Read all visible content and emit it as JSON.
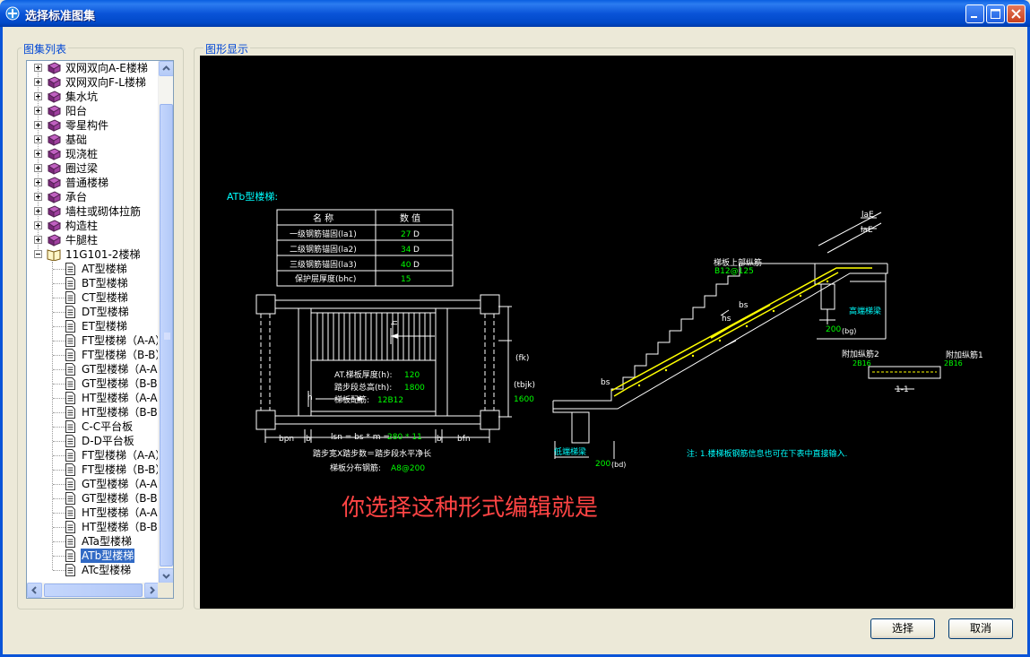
{
  "window": {
    "title": "选择标准图集",
    "colors": {
      "titlebar": "#0a54d8",
      "selection": "#316ac5",
      "drawing_bg": "#000000",
      "accent_yellow": "#ffff00",
      "text_green": "#00ff00",
      "text_cyan": "#00ffff",
      "annotation_red": "#ff3333"
    }
  },
  "left_panel": {
    "label": "图集列表"
  },
  "right_panel": {
    "label": "图形显示"
  },
  "tree": {
    "items": [
      {
        "label": "双网双向A-E楼梯",
        "icon": "book-icon",
        "level": 0
      },
      {
        "label": "双网双向F-L楼梯",
        "icon": "book-icon",
        "level": 0
      },
      {
        "label": "集水坑",
        "icon": "book-icon",
        "level": 0
      },
      {
        "label": "阳台",
        "icon": "book-icon",
        "level": 0
      },
      {
        "label": "零星构件",
        "icon": "book-icon",
        "level": 0
      },
      {
        "label": "基础",
        "icon": "book-icon",
        "level": 0
      },
      {
        "label": "现浇桩",
        "icon": "book-icon",
        "level": 0
      },
      {
        "label": "圈过梁",
        "icon": "book-icon",
        "level": 0
      },
      {
        "label": "普通楼梯",
        "icon": "book-icon",
        "level": 0
      },
      {
        "label": "承台",
        "icon": "book-icon",
        "level": 0
      },
      {
        "label": "墙柱或砌体拉筋",
        "icon": "book-icon",
        "level": 0
      },
      {
        "label": "构造柱",
        "icon": "book-icon",
        "level": 0
      },
      {
        "label": "牛腿柱",
        "icon": "book-icon",
        "level": 0
      },
      {
        "label": "11G101-2楼梯",
        "icon": "open-book-icon",
        "level": 0
      },
      {
        "label": "AT型楼梯",
        "icon": "document-icon",
        "level": 1
      },
      {
        "label": "BT型楼梯",
        "icon": "document-icon",
        "level": 1
      },
      {
        "label": "CT型楼梯",
        "icon": "document-icon",
        "level": 1
      },
      {
        "label": "DT型楼梯",
        "icon": "document-icon",
        "level": 1
      },
      {
        "label": "ET型楼梯",
        "icon": "document-icon",
        "level": 1
      },
      {
        "label": "FT型楼梯（A-A）",
        "icon": "document-icon",
        "level": 1
      },
      {
        "label": "FT型楼梯（B-B）",
        "icon": "document-icon",
        "level": 1
      },
      {
        "label": "GT型楼梯（A-A）",
        "icon": "document-icon",
        "level": 1
      },
      {
        "label": "GT型楼梯（B-B）",
        "icon": "document-icon",
        "level": 1
      },
      {
        "label": "HT型楼梯（A-A）",
        "icon": "document-icon",
        "level": 1
      },
      {
        "label": "HT型楼梯（B-B）",
        "icon": "document-icon",
        "level": 1
      },
      {
        "label": "C-C平台板",
        "icon": "document-icon",
        "level": 1
      },
      {
        "label": "D-D平台板",
        "icon": "document-icon",
        "level": 1
      },
      {
        "label": "FT型楼梯（A-A）",
        "icon": "document-icon",
        "level": 1
      },
      {
        "label": "FT型楼梯（B-B）",
        "icon": "document-icon",
        "level": 1
      },
      {
        "label": "GT型楼梯（A-A）",
        "icon": "document-icon",
        "level": 1
      },
      {
        "label": "GT型楼梯（B-B）",
        "icon": "document-icon",
        "level": 1
      },
      {
        "label": "HT型楼梯（A-A）",
        "icon": "document-icon",
        "level": 1
      },
      {
        "label": "HT型楼梯（B-B）",
        "icon": "document-icon",
        "level": 1
      },
      {
        "label": "ATa型楼梯",
        "icon": "document-icon",
        "level": 1
      },
      {
        "label": "ATb型楼梯",
        "icon": "document-icon",
        "level": 1,
        "selected": true
      },
      {
        "label": "ATc型楼梯",
        "icon": "document-icon",
        "level": 1
      }
    ]
  },
  "drawing": {
    "heading": "ATb型楼梯:",
    "table": {
      "headers": [
        "名 称",
        "数 值"
      ],
      "rows": [
        {
          "name": "一级钢筋锚固(la1)",
          "value": "27",
          "unit": "D"
        },
        {
          "name": "二级钢筋锚固(la2)",
          "value": "34",
          "unit": "D"
        },
        {
          "name": "三级钢筋锚固(la3)",
          "value": "40",
          "unit": "D"
        },
        {
          "name": "保护层厚度(bhc)",
          "value": "15",
          "unit": ""
        }
      ]
    },
    "plan": {
      "slab_thickness_label": "AT.梯板厚度(h):",
      "slab_thickness_value": "120",
      "total_height_label": "踏步段总高(th):",
      "total_height_value": "1800",
      "rebar_label": "梯板配筋:",
      "rebar_value": "12B12",
      "fk": "(fk)",
      "tbjk": "(tbjk)",
      "tbjk_value": "1600",
      "bpn": "bpn",
      "b1": "b",
      "lsn_formula": "lsn = bs * m =",
      "lsn_value": "280 * 11",
      "b2": "b",
      "bfn": "bfn",
      "bottom_line1": "踏步宽X踏步数＝踏步段水平净长",
      "bottom_line2_label": "梯板分布钢筋:",
      "bottom_line2_value": "A8@200",
      "h_mark": "h"
    },
    "section": {
      "lae1": "laE",
      "lae2": "laE",
      "top_rebar_label": "梯板上部纵筋",
      "top_rebar_value": "B12@125",
      "high_beam": "高端梯梁",
      "high_beam_dim": "200",
      "high_beam_bg": "(bg)",
      "bs_top": "bs",
      "hs": "hs",
      "bs_bottom": "bs",
      "low_beam": "低端梯梁",
      "low_beam_dim": "200",
      "low_beam_bd": "(bd)",
      "add_rebar2_label": "附加纵筋2",
      "add_rebar2_value": "2B16",
      "add_rebar1_label": "附加纵筋1",
      "add_rebar1_value": "2B16",
      "section_mark": "1-1",
      "note": "注: 1.楼梯板钢筋信息也可在下表中直接输入."
    },
    "annotation": "你选择这种形式编辑就是"
  },
  "buttons": {
    "select": "选择",
    "cancel": "取消"
  }
}
